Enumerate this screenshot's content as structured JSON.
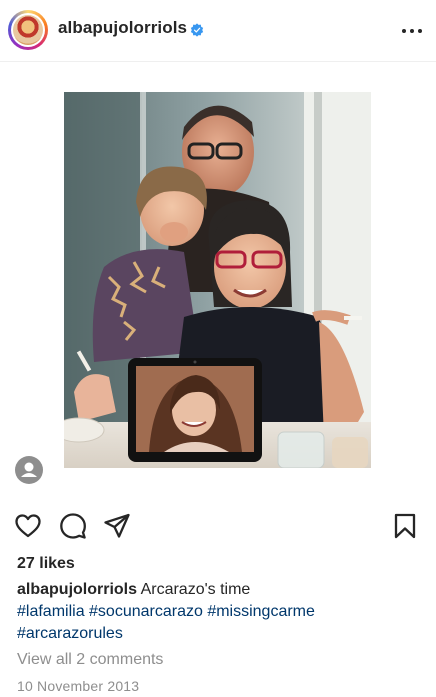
{
  "header": {
    "username": "albapujolorriols",
    "verified": true,
    "more_icon": "more-horizontal-icon"
  },
  "post": {
    "image_description_icon": "photo",
    "tagged_user_icon": "user-tag-icon"
  },
  "actions": {
    "like_icon": "heart-icon",
    "comment_icon": "comment-icon",
    "share_icon": "send-icon",
    "save_icon": "bookmark-icon"
  },
  "likes": "27 likes",
  "caption": {
    "username": "albapujolorriols",
    "text": "Arcarazo's time",
    "hashtags_line1": "#lafamilia #socunarcarazo #missingcarme",
    "hashtags_line2": "#arcarazorules"
  },
  "comments_link": "View all 2 comments",
  "date": "10 November 2013",
  "colors": {
    "link": "#00376b",
    "muted": "#8e8e8e",
    "verified": "#3897f0"
  }
}
